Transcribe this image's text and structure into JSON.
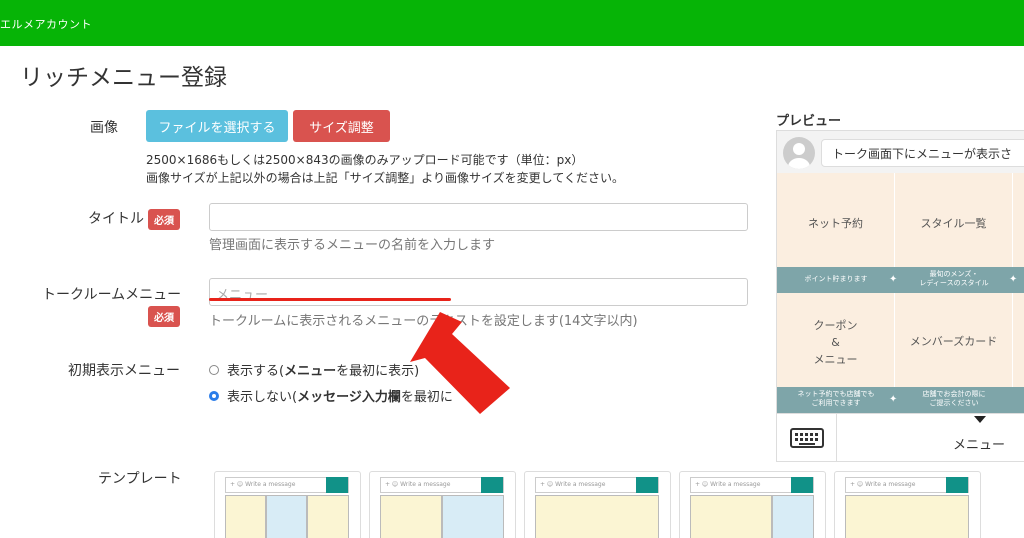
{
  "header": {
    "brand": "エルメアカウント",
    "bg_color": "#06b406"
  },
  "page": {
    "title": "リッチメニュー登録"
  },
  "image_field": {
    "label": "画像",
    "file_button": "ファイルを選択する",
    "resize_button": "サイズ調整",
    "note_line1": "2500×1686もしくは2500×843の画像のみアップロード可能です（単位：px）",
    "note_line2": "画像サイズが上記以外の場合は上記「サイズ調整」より画像サイズを変更してください。"
  },
  "title_field": {
    "label": "タイトル",
    "required": "必須",
    "value": "",
    "help": "管理画面に表示するメニューの名前を入力します"
  },
  "talkroom_field": {
    "label": "トークルームメニュー",
    "required": "必須",
    "placeholder": "メニュー",
    "help": "トークルームに表示されるメニューのテキストを設定します(14文字以内)"
  },
  "initial_display": {
    "label": "初期表示メニュー",
    "options": [
      {
        "pre": "表示する(",
        "bold": "メニュー",
        "post": "を最初に表示)",
        "selected": false
      },
      {
        "pre": "表示しない(",
        "bold": "メッセージ入力欄",
        "post": "を最初に",
        "selected": true
      }
    ]
  },
  "template": {
    "label": "テンプレート",
    "bar_text": "+ ☺ Write a message",
    "items": [
      {
        "cells": [
          [
            "y",
            "w1"
          ],
          [
            "b",
            "w1"
          ],
          [
            "y",
            "w1"
          ]
        ]
      },
      {
        "cells": [
          [
            "y",
            "w1"
          ],
          [
            "b",
            "w1"
          ]
        ]
      },
      {
        "cells": [
          [
            "y",
            "w1"
          ]
        ]
      },
      {
        "cells": [
          [
            "y",
            "w2"
          ],
          [
            "b",
            "w1"
          ]
        ]
      },
      {
        "cells": [
          [
            "y",
            "w1"
          ]
        ]
      }
    ]
  },
  "preview": {
    "label": "プレビュー",
    "message_text": "トーク画面下にメニューが表示さ",
    "tiles_top": [
      "ネット予約",
      "スタイル一覧"
    ],
    "strip_top": [
      "ポイント貯まります",
      "最旬のメンズ・\nレディースのスタイル"
    ],
    "tiles_bottom": [
      "クーポン\n&\nメニュー",
      "メンバーズカード"
    ],
    "strip_bottom": [
      "ネット予約でも店舗でも\nご利用できます",
      "店舗でお会計の際に\nご提示ください"
    ],
    "menu_label": "メニュー",
    "keyboard_icon": "keyboard-icon"
  },
  "colors": {
    "accent": "#06b406",
    "info_button": "#5bc0de",
    "danger_button": "#d9534f",
    "annotation_red": "#e8231a",
    "teal": "#119288"
  }
}
